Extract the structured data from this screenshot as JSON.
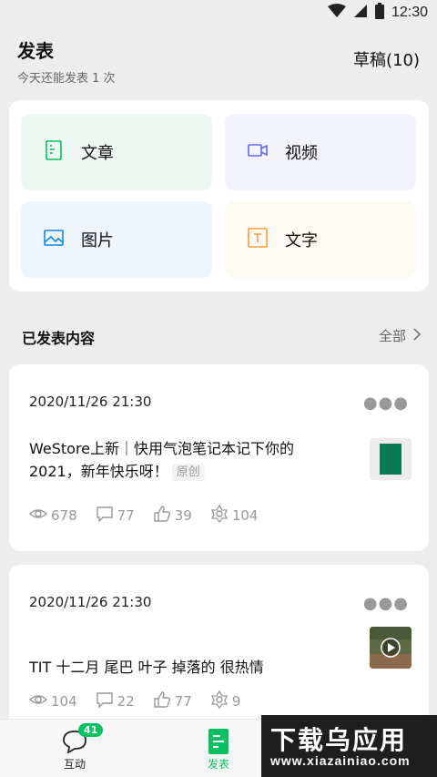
{
  "status_bar": {
    "time": "12:30"
  },
  "header": {
    "title": "发表",
    "subtitle": "今天还能发表 1 次",
    "drafts": "草稿(10)"
  },
  "publish_options": [
    {
      "label": "文章",
      "icon": "document-icon",
      "color": "#07c160"
    },
    {
      "label": "视频",
      "icon": "video-icon",
      "color": "#6467f0"
    },
    {
      "label": "图片",
      "icon": "image-icon",
      "color": "#1485ee"
    },
    {
      "label": "文字",
      "icon": "text-icon",
      "color": "#fa9d3b"
    }
  ],
  "published": {
    "section_title": "已发表内容",
    "view_all": "全部"
  },
  "posts": [
    {
      "date": "2020/11/26 21:30",
      "title": "WeStore上新｜快用气泡笔记本记下你的2021，新年快乐呀！",
      "badge": "原创",
      "views": "678",
      "comments": "77",
      "likes": "39",
      "shares": "104"
    },
    {
      "date": "2020/11/26 21:30",
      "title": "TIT 十二月 尾巴 叶子 掉落的 很热情",
      "views": "104",
      "comments": "22",
      "likes": "77",
      "shares": "9"
    }
  ],
  "tabbar": {
    "interact_label": "互动",
    "interact_badge": "41",
    "publish_label": "发表"
  },
  "watermark": {
    "main": "下载乌应用",
    "sub": "www.xiazainiao.com"
  },
  "colors": {
    "accent": "#07c160",
    "background": "#ededed"
  }
}
